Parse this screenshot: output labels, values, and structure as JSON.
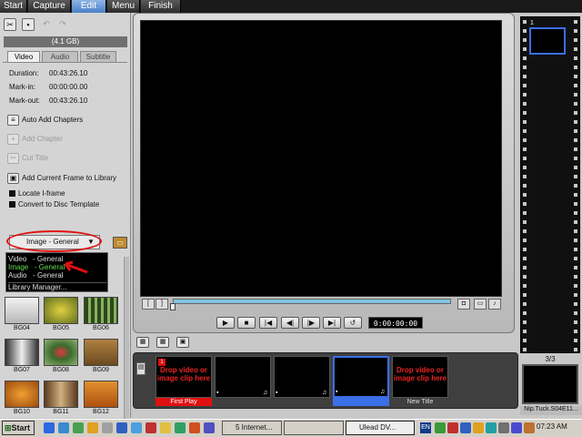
{
  "menu": {
    "tabs": [
      "Start",
      "Capture",
      "Edit",
      "Menu",
      "Finish"
    ],
    "active": "Edit"
  },
  "left": {
    "disc_label": "(4.1 GB)",
    "subtabs": [
      "Video",
      "Audio",
      "Subtitle"
    ],
    "info": [
      {
        "label": "Duration:",
        "value": "00:43:26.10"
      },
      {
        "label": "Mark-in:",
        "value": "00:00:00.00"
      },
      {
        "label": "Mark-out:",
        "value": "00:43:26.10"
      }
    ],
    "actions": {
      "auto_chapters": "Auto Add Chapters",
      "add_chapter": "Add Chapter",
      "cut_title": "Cut Title",
      "add_frame": "Add Current Frame to Library"
    },
    "checks": {
      "locate": "Locate I-frame",
      "convert": "Convert to Disc Template"
    },
    "library": {
      "selected": "Image - General",
      "options": [
        "Video   - General",
        "Image   - General",
        "Audio   - General",
        "Library Manager..."
      ]
    },
    "thumbs": [
      "BG04",
      "BG05",
      "BG06",
      "BG07",
      "BG08",
      "BG09",
      "BG10",
      "BG11",
      "BG12"
    ]
  },
  "player": {
    "timecode": "0:00:00:00"
  },
  "filmstrip": {
    "number": "1",
    "count": "3/3",
    "label": "Nip.Tuck.S04E11..."
  },
  "menustrip": {
    "slot1_num": "1",
    "drop_text": "Drop video or image clip here",
    "first_play": "First Play",
    "new_title": "New Title"
  },
  "taskbar": {
    "start": "Start",
    "items": [
      "5 Internet...",
      "",
      "Ulead DV..."
    ],
    "lang": "EN",
    "clock": "07:23 AM"
  }
}
